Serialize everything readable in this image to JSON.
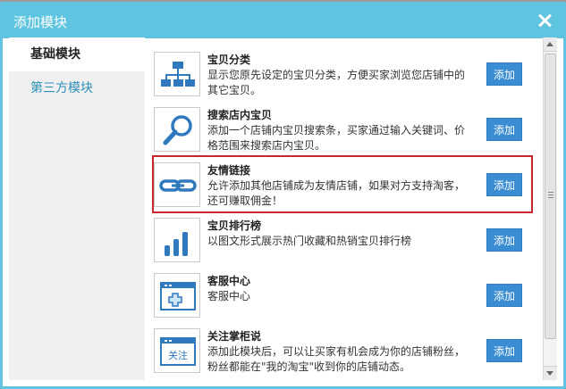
{
  "dialog": {
    "title": "添加模块"
  },
  "sidebar": {
    "items": [
      {
        "label": "基础模块",
        "active": true
      },
      {
        "label": "第三方模块",
        "active": false
      }
    ]
  },
  "modules": [
    {
      "title": "宝贝分类",
      "desc": "显示您原先设定的宝贝分类，方便买家浏览您店铺中的其它宝贝。",
      "icon": "category-tree-icon",
      "button": "添加"
    },
    {
      "title": "搜索店内宝贝",
      "desc": "添加一个店铺内宝贝搜索条，买家通过输入关键词、价格范围来搜索店内宝贝。",
      "icon": "magnifier-icon",
      "button": "添加"
    },
    {
      "title": "友情链接",
      "desc": "允许添加其他店铺成为友情店铺，如果对方支持淘客，还可赚取佣金！",
      "icon": "chain-link-icon",
      "button": "添加",
      "highlighted": true
    },
    {
      "title": "宝贝排行榜",
      "desc": "以图文形式展示热门收藏和热销宝贝排行榜",
      "icon": "bar-ranking-icon",
      "button": "添加"
    },
    {
      "title": "客服中心",
      "desc": "客服中心",
      "icon": "customer-service-window-icon",
      "button": "添加"
    },
    {
      "title": "关注掌柜说",
      "desc": "添加此模块后，可以让买家有机会成为你的店铺粉丝，粉丝都能在\"我的淘宝\"收到你的店铺动态。",
      "icon": "follow-window-icon",
      "icon_text": "关注",
      "button": "添加"
    }
  ],
  "colors": {
    "titlebar": "#5ec4df",
    "accent": "#3a8cd3",
    "highlight": "#c8272d"
  }
}
